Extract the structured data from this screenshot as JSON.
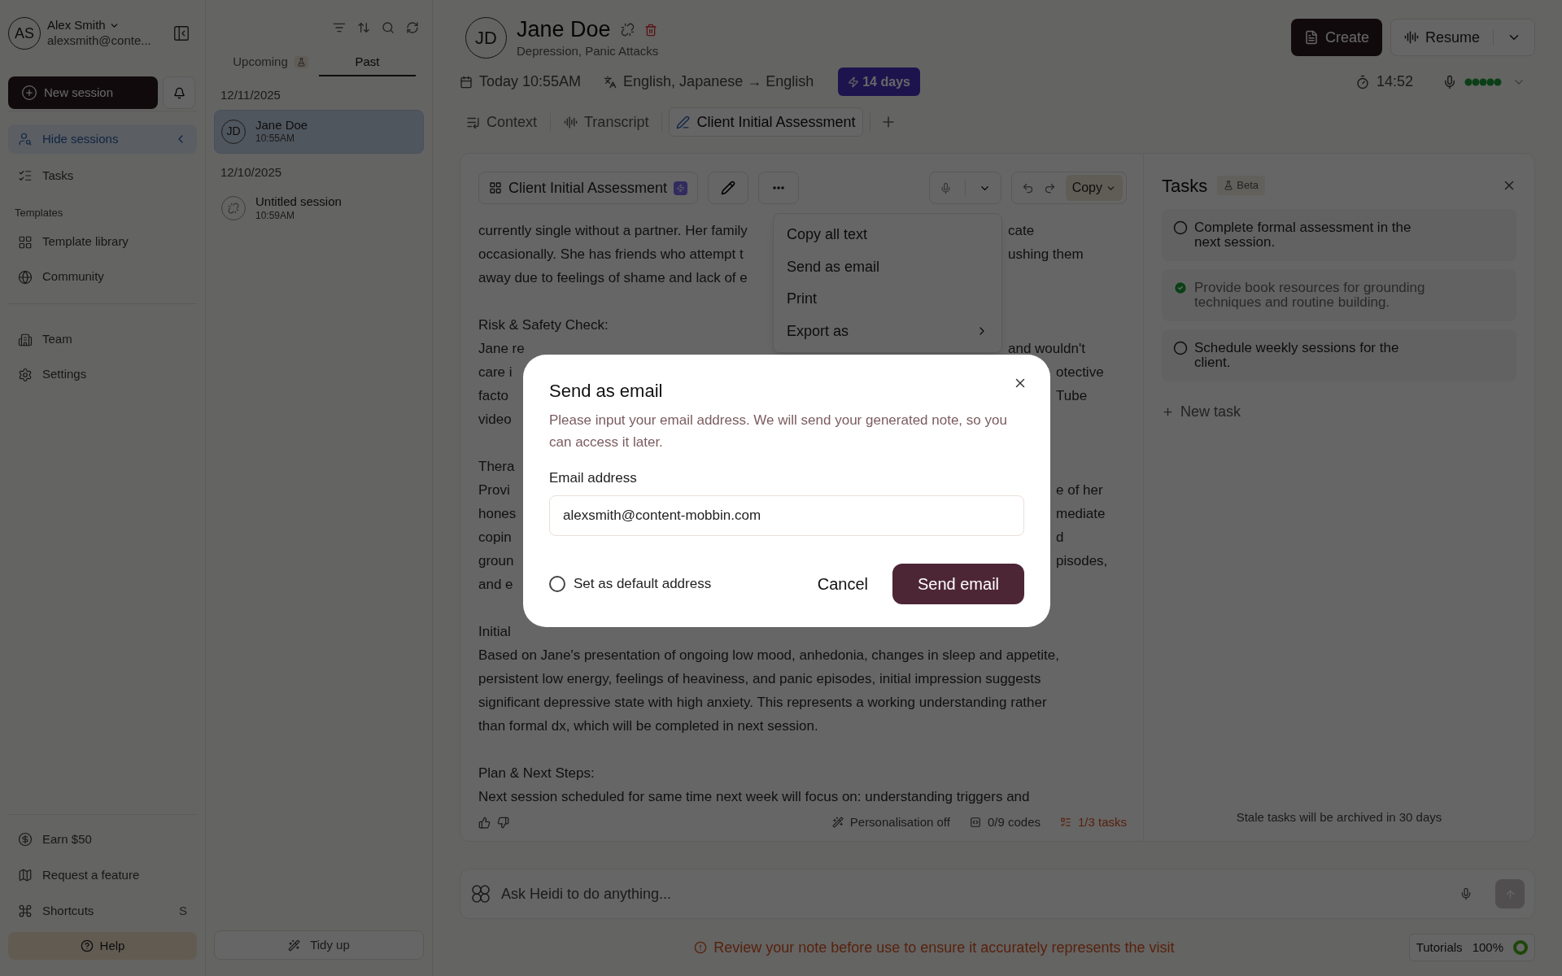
{
  "sidebar": {
    "user": {
      "initials": "AS",
      "name": "Alex Smith",
      "email": "alexsmith@conte..."
    },
    "new_session": "New session",
    "nav": [
      {
        "kind": "sessions",
        "label": "Hide sessions",
        "selected": true
      },
      {
        "kind": "tasks",
        "label": "Tasks",
        "selected": false
      }
    ],
    "templates_heading": "Templates",
    "templates": [
      {
        "kind": "library",
        "label": "Template library",
        "selected": false
      },
      {
        "kind": "community",
        "label": "Community",
        "selected": false
      }
    ],
    "admin": [
      {
        "kind": "team",
        "label": "Team",
        "selected": false
      },
      {
        "kind": "settings",
        "label": "Settings",
        "selected": false
      }
    ],
    "bottom": [
      {
        "kind": "earn",
        "label": "Earn $50"
      },
      {
        "kind": "request",
        "label": "Request a feature"
      },
      {
        "kind": "shortcuts",
        "label": "Shortcuts",
        "shortcut": "S"
      }
    ],
    "help": "Help"
  },
  "sessions": {
    "tabs": [
      {
        "label": "Upcoming",
        "selected": false,
        "beta": true
      },
      {
        "label": "Past",
        "selected": true,
        "beta": false
      }
    ],
    "groups": [
      {
        "date": "12/11/2025",
        "items": [
          {
            "kind": "patient",
            "initials": "JD",
            "name": "Jane Doe",
            "time": "10:55AM",
            "selected": true
          }
        ]
      },
      {
        "date": "12/10/2025",
        "items": [
          {
            "kind": "untitled",
            "name": "Untitled session",
            "time": "10:59AM",
            "selected": false
          }
        ]
      }
    ],
    "tidy_up": "Tidy up"
  },
  "header": {
    "initials": "JD",
    "name": "Jane Doe",
    "subtitle": "Depression, Panic Attacks",
    "date": "Today 10:55AM",
    "languages": "English, Japanese → English",
    "trial": "14 days",
    "timer": "14:52",
    "create": "Create",
    "resume": "Resume"
  },
  "tabs": [
    {
      "kind": "context",
      "label": "Context",
      "selected": false
    },
    {
      "kind": "transcript",
      "label": "Transcript",
      "selected": false
    },
    {
      "kind": "note",
      "label": "Client Initial Assessment",
      "selected": true
    }
  ],
  "note": {
    "template": "Client Initial Assessment",
    "copy": "Copy",
    "paragraphs": [
      [
        {
          "kind": "menu",
          "left": "currently single without a partner. Her family",
          "right": "cate"
        },
        {
          "kind": "menu",
          "left": "occasionally. She has friends who attempt t",
          "right": "ushing them"
        },
        {
          "kind": "menu",
          "left": "away due to feelings of shame and lack of e"
        }
      ],
      [
        {
          "kind": "full",
          "left": "Risk & Safety Check:"
        },
        {
          "kind": "menu",
          "left": "Jane re",
          "right": "and wouldn't"
        },
        {
          "kind": "modal",
          "left": "care i",
          "right": "otective"
        },
        {
          "kind": "modal",
          "left": "facto",
          "right": "Tube"
        },
        {
          "kind": "modal",
          "left": "video"
        }
      ],
      [
        {
          "kind": "modal",
          "left": "Thera"
        },
        {
          "kind": "modal",
          "left": "Provi",
          "right": "e of her"
        },
        {
          "kind": "modal",
          "left": "hones",
          "right": "mediate"
        },
        {
          "kind": "modal",
          "left": "copin",
          "right": "d"
        },
        {
          "kind": "modal",
          "left": "groun",
          "right": "pisodes,"
        },
        {
          "kind": "modal",
          "left": "and e"
        }
      ],
      [
        {
          "kind": "full",
          "left": "Initial"
        },
        {
          "kind": "full",
          "left": "Based on Jane's presentation of ongoing low mood, anhedonia, changes in sleep and appetite,"
        },
        {
          "kind": "full",
          "left": "persistent low energy, feelings of heaviness, and panic episodes, initial impression suggests"
        },
        {
          "kind": "full",
          "left": "significant depressive state with high anxiety. This represents a working understanding rather"
        },
        {
          "kind": "full",
          "left": "than formal dx, which will be completed in next session."
        }
      ],
      [
        {
          "kind": "full",
          "left": "Plan & Next Steps:"
        },
        {
          "kind": "full",
          "left": "Next session scheduled for same time next week will focus on: understanding triggers and"
        }
      ]
    ],
    "personalisation": "Personalisation off",
    "codes": "0/9 codes",
    "tasks": "1/3 tasks"
  },
  "menu": [
    {
      "label": "Copy all text",
      "submenu": false
    },
    {
      "label": "Send as email",
      "submenu": false
    },
    {
      "label": "Print",
      "submenu": false
    },
    {
      "label": "Export as",
      "submenu": true
    }
  ],
  "tasks_panel": {
    "title": "Tasks",
    "badge": "Beta",
    "items": [
      {
        "text": "Complete formal assessment in the next session.",
        "checked": false
      },
      {
        "text": "Provide book resources for grounding techniques and routine building.",
        "checked": true
      },
      {
        "text": "Schedule weekly sessions for the client.",
        "checked": false
      }
    ],
    "new_task": "New task",
    "footer": "Stale tasks will be archived in 30 days"
  },
  "ask": {
    "placeholder": "Ask Heidi to do anything..."
  },
  "warning": "Review your note before use to ensure it accurately represents the visit",
  "tutorials": {
    "label": "Tutorials",
    "percent": "100%"
  },
  "dialog": {
    "title": "Send as email",
    "description": "Please input your email address. We will send your generated note, so you can access it later.",
    "field_label": "Email address",
    "value": "alexsmith@content-mobbin.com",
    "checkbox": {
      "label": "Set as default address",
      "checked": false
    },
    "cancel": "Cancel",
    "submit": "Send email"
  }
}
